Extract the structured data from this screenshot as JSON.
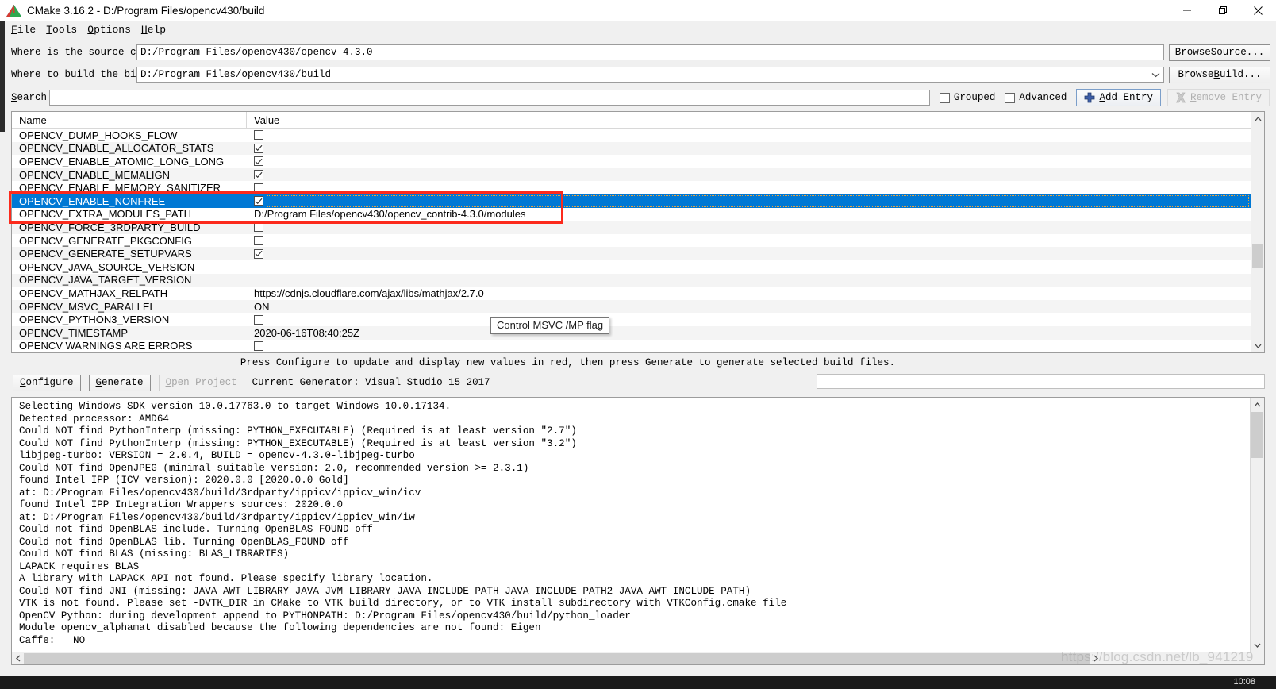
{
  "window": {
    "title": "CMake 3.16.2 - D:/Program Files/opencv430/build",
    "minimize_label": "Minimize",
    "maximize_label": "Restore",
    "close_label": "Close"
  },
  "menu": {
    "items": [
      {
        "pre": "",
        "key": "F",
        "post": "ile"
      },
      {
        "pre": "",
        "key": "T",
        "post": "ools"
      },
      {
        "pre": "",
        "key": "O",
        "post": "ptions"
      },
      {
        "pre": "",
        "key": "H",
        "post": "elp"
      }
    ]
  },
  "paths": {
    "source_label": "Where is the source code:",
    "source_value": "D:/Program Files/opencv430/opencv-4.3.0",
    "build_label": "Where to build the binaries:",
    "build_value": "D:/Program Files/opencv430/build",
    "browse_source": "Browse Source...",
    "browse_source_pre": "Browse ",
    "browse_source_key": "S",
    "browse_source_post": "ource...",
    "browse_build_pre": "Browse ",
    "browse_build_key": "B",
    "browse_build_post": "uild..."
  },
  "search": {
    "label_pre": "",
    "label_key": "S",
    "label_post": "earch:",
    "value": "",
    "grouped_label": "Grouped",
    "grouped_checked": false,
    "advanced_label": "Advanced",
    "advanced_checked": false,
    "add_entry_pre": "",
    "add_entry_key": "A",
    "add_entry_post": "dd Entry",
    "remove_entry_pre": "",
    "remove_entry_key": "R",
    "remove_entry_post": "emove Entry",
    "remove_entry_disabled": true
  },
  "cache_table": {
    "columns": [
      "Name",
      "Value"
    ],
    "rows": [
      {
        "name": "OPENCV_DUMP_HOOKS_FLOW",
        "type": "checkbox",
        "checked": false,
        "value": "",
        "selected": false
      },
      {
        "name": "OPENCV_ENABLE_ALLOCATOR_STATS",
        "type": "checkbox",
        "checked": true,
        "value": "",
        "selected": false
      },
      {
        "name": "OPENCV_ENABLE_ATOMIC_LONG_LONG",
        "type": "checkbox",
        "checked": true,
        "value": "",
        "selected": false
      },
      {
        "name": "OPENCV_ENABLE_MEMALIGN",
        "type": "checkbox",
        "checked": true,
        "value": "",
        "selected": false
      },
      {
        "name": "OPENCV_ENABLE_MEMORY_SANITIZER",
        "type": "checkbox",
        "checked": false,
        "value": "",
        "selected": false
      },
      {
        "name": "OPENCV_ENABLE_NONFREE",
        "type": "checkbox",
        "checked": true,
        "value": "",
        "selected": true
      },
      {
        "name": "OPENCV_EXTRA_MODULES_PATH",
        "type": "text",
        "checked": false,
        "value": "D:/Program Files/opencv430/opencv_contrib-4.3.0/modules",
        "selected": false
      },
      {
        "name": "OPENCV_FORCE_3RDPARTY_BUILD",
        "type": "checkbox",
        "checked": false,
        "value": "",
        "selected": false
      },
      {
        "name": "OPENCV_GENERATE_PKGCONFIG",
        "type": "checkbox",
        "checked": false,
        "value": "",
        "selected": false
      },
      {
        "name": "OPENCV_GENERATE_SETUPVARS",
        "type": "checkbox",
        "checked": true,
        "value": "",
        "selected": false
      },
      {
        "name": "OPENCV_JAVA_SOURCE_VERSION",
        "type": "text",
        "checked": false,
        "value": "",
        "selected": false
      },
      {
        "name": "OPENCV_JAVA_TARGET_VERSION",
        "type": "text",
        "checked": false,
        "value": "",
        "selected": false
      },
      {
        "name": "OPENCV_MATHJAX_RELPATH",
        "type": "text",
        "checked": false,
        "value": "https://cdnjs.cloudflare.com/ajax/libs/mathjax/2.7.0",
        "selected": false
      },
      {
        "name": "OPENCV_MSVC_PARALLEL",
        "type": "text",
        "checked": false,
        "value": "ON",
        "selected": false
      },
      {
        "name": "OPENCV_PYTHON3_VERSION",
        "type": "checkbox",
        "checked": false,
        "value": "",
        "selected": false
      },
      {
        "name": "OPENCV_TIMESTAMP",
        "type": "text",
        "checked": false,
        "value": "2020-06-16T08:40:25Z",
        "selected": false
      },
      {
        "name": "OPENCV WARNINGS ARE ERRORS",
        "type": "checkbox",
        "checked": false,
        "value": "",
        "selected": false
      }
    ]
  },
  "tooltip": {
    "text": "Control MSVC /MP flag"
  },
  "status": {
    "message": "Press Configure to update and display new values in red, then press Generate to generate selected build files."
  },
  "actions": {
    "configure_pre": "",
    "configure_key": "C",
    "configure_post": "onfigure",
    "generate_pre": "",
    "generate_key": "G",
    "generate_post": "enerate",
    "open_project_pre": "",
    "open_project_key": "O",
    "open_project_post": "pen Project",
    "open_project_disabled": true,
    "generator_text": "Current Generator: Visual Studio 15 2017"
  },
  "console": {
    "lines": [
      "Selecting Windows SDK version 10.0.17763.0 to target Windows 10.0.17134.",
      "Detected processor: AMD64",
      "Could NOT find PythonInterp (missing: PYTHON_EXECUTABLE) (Required is at least version \"2.7\")",
      "Could NOT find PythonInterp (missing: PYTHON_EXECUTABLE) (Required is at least version \"3.2\")",
      "libjpeg-turbo: VERSION = 2.0.4, BUILD = opencv-4.3.0-libjpeg-turbo",
      "Could NOT find OpenJPEG (minimal suitable version: 2.0, recommended version >= 2.3.1)",
      "found Intel IPP (ICV version): 2020.0.0 [2020.0.0 Gold]",
      "at: D:/Program Files/opencv430/build/3rdparty/ippicv/ippicv_win/icv",
      "found Intel IPP Integration Wrappers sources: 2020.0.0",
      "at: D:/Program Files/opencv430/build/3rdparty/ippicv/ippicv_win/iw",
      "Could not find OpenBLAS include. Turning OpenBLAS_FOUND off",
      "Could not find OpenBLAS lib. Turning OpenBLAS_FOUND off",
      "Could NOT find BLAS (missing: BLAS_LIBRARIES)",
      "LAPACK requires BLAS",
      "A library with LAPACK API not found. Please specify library location.",
      "Could NOT find JNI (missing: JAVA_AWT_LIBRARY JAVA_JVM_LIBRARY JAVA_INCLUDE_PATH JAVA_INCLUDE_PATH2 JAVA_AWT_INCLUDE_PATH)",
      "VTK is not found. Please set -DVTK_DIR in CMake to VTK build directory, or to VTK install subdirectory with VTKConfig.cmake file",
      "OpenCV Python: during development append to PYTHONPATH: D:/Program Files/opencv430/build/python_loader",
      "Module opencv_alphamat disabled because the following dependencies are not found: Eigen",
      "Caffe:   NO"
    ]
  },
  "watermark": {
    "text": "https://blog.csdn.net/lb_941219"
  },
  "taskbar": {
    "clock": "10:08"
  },
  "colors": {
    "selection_blue": "#0078d4",
    "annotation_red": "#fc2a1c",
    "window_bg": "#f0f0f0",
    "row_alt": "#f4f4f4"
  }
}
